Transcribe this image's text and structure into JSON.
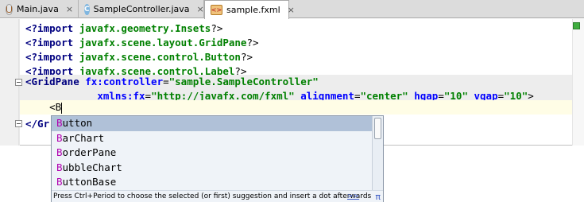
{
  "tabs": [
    {
      "label": "Main.java",
      "icon": "java-file-icon",
      "active": false
    },
    {
      "label": "SampleController.java",
      "icon": "class-icon",
      "active": false
    },
    {
      "label": "sample.fxml",
      "icon": "fxml-file-icon",
      "active": true
    }
  ],
  "tab_icon_letters": {
    "class": "C",
    "fxml": "<>"
  },
  "close_glyph": "×",
  "code": {
    "import1": {
      "kw": "<?import",
      "val": " javafx.geometry.Insets",
      "end": "?>"
    },
    "import2": {
      "kw": "<?import",
      "val": " javafx.scene.layout.GridPane",
      "end": "?>"
    },
    "import3": {
      "kw": "<?import",
      "val": " javafx.scene.control.Button",
      "end": "?>"
    },
    "import4": {
      "kw": "<?import",
      "val": " javafx.scene.control.Label",
      "end": "?>"
    },
    "gridpane_open": {
      "tag": "<GridPane",
      "attr1": " fx:controller",
      "eq": "=",
      "val1": "\"sample.SampleController\""
    },
    "gridpane_attrs": {
      "indent": "            ",
      "a1": "xmlns:fx",
      "v1": "\"http://javafx.com/fxml\"",
      "a2": " alignment",
      "v2": "\"center\"",
      "a3": " hgap",
      "v3": "\"10\"",
      "a4": " vgap",
      "v4": "\"10\"",
      "end": ">"
    },
    "typed": {
      "indent": "    ",
      "text": "<B"
    },
    "gridpane_close": {
      "text": "</Gr"
    }
  },
  "completion": {
    "match_prefix": "B",
    "items": [
      {
        "rest": "utton",
        "selected": true
      },
      {
        "rest": "arChart",
        "selected": false
      },
      {
        "rest": "orderPane",
        "selected": false
      },
      {
        "rest": "ubbleChart",
        "selected": false
      },
      {
        "rest": "uttonBase",
        "selected": false
      }
    ],
    "footer_text": "Press Ctrl+Period to choose the selected (or first) suggestion and insert a dot afterwards",
    "footer_link": ">>",
    "pi_glyph": "π"
  },
  "colors": {
    "keyword": "#000080",
    "attribute": "#0000ff",
    "string": "#008000",
    "match": "#b000b0",
    "selection": "#b0c1d8",
    "status_ok": "#3fad3f"
  }
}
